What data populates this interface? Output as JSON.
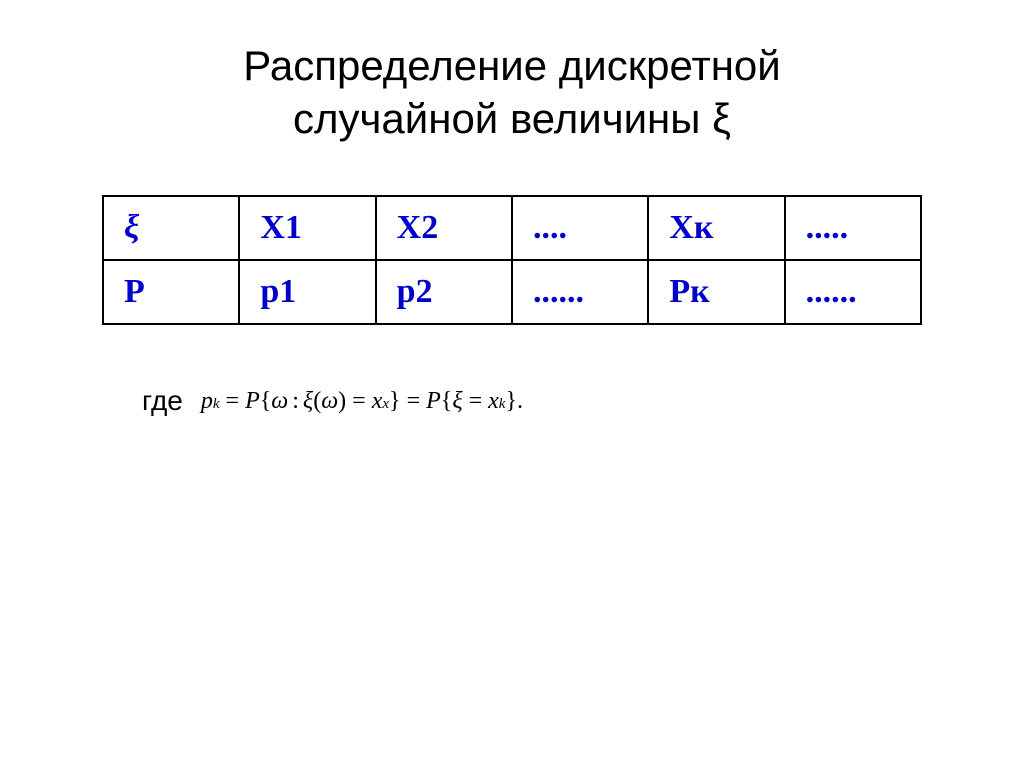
{
  "title": {
    "line1": "Распределение дискретной",
    "line2": "случайной величины ξ"
  },
  "table": {
    "headers": [
      "ξ",
      "X1",
      "X2",
      "....",
      "Xк",
      "....."
    ],
    "row2": [
      "P",
      "p1",
      "p2",
      "......",
      "Рк",
      "......"
    ]
  },
  "formula": {
    "prefix": "где",
    "expression": "p_k = P{ω : ξ(ω) = x_x} = P{ξ = x_k}."
  }
}
